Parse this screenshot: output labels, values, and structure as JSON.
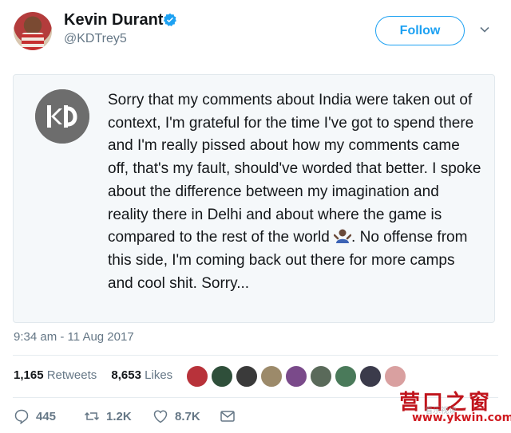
{
  "header": {
    "display_name": "Kevin Durant",
    "handle": "@KDTrey5",
    "follow_label": "Follow",
    "verified": true
  },
  "tweet": {
    "text_before_emoji": "Sorry that my comments about India were taken out of context, I'm grateful for the time I've got to spend there and I'm really pissed about how my comments came off, that's my fault, should've worded that better. I spoke about the difference between my imagination and reality there in Delhi and about where the game is compared to the rest of the world ",
    "emoji": "shrug-emoji",
    "text_after_emoji": ". No offense from this side, I'm coming back out there for more camps and cool shit. Sorry...",
    "timestamp": "9:34 am - 11 Aug 2017"
  },
  "stats": {
    "retweets_count": "1,165",
    "retweets_label": "Retweets",
    "likes_count": "8,653",
    "likes_label": "Likes"
  },
  "likers": [
    {
      "color": "#b8323a"
    },
    {
      "color": "#2f4f3a"
    },
    {
      "color": "#3a3a3a"
    },
    {
      "color": "#9c8a6a"
    },
    {
      "color": "#7a4a8a"
    },
    {
      "color": "#5a6a5a"
    },
    {
      "color": "#4a7a5a"
    },
    {
      "color": "#3b3b4b"
    },
    {
      "color": "#d9a0a0"
    }
  ],
  "actions": {
    "replies": "445",
    "retweets": "1.2K",
    "likes": "8.7K"
  },
  "watermark": {
    "chinese": "营口之窗",
    "url": "www.ykwin.com",
    "sub": "看乐视读"
  },
  "colors": {
    "accent": "#1da1f2",
    "muted": "#657786",
    "text": "#14171a",
    "card_bg": "#f5f8fa"
  }
}
